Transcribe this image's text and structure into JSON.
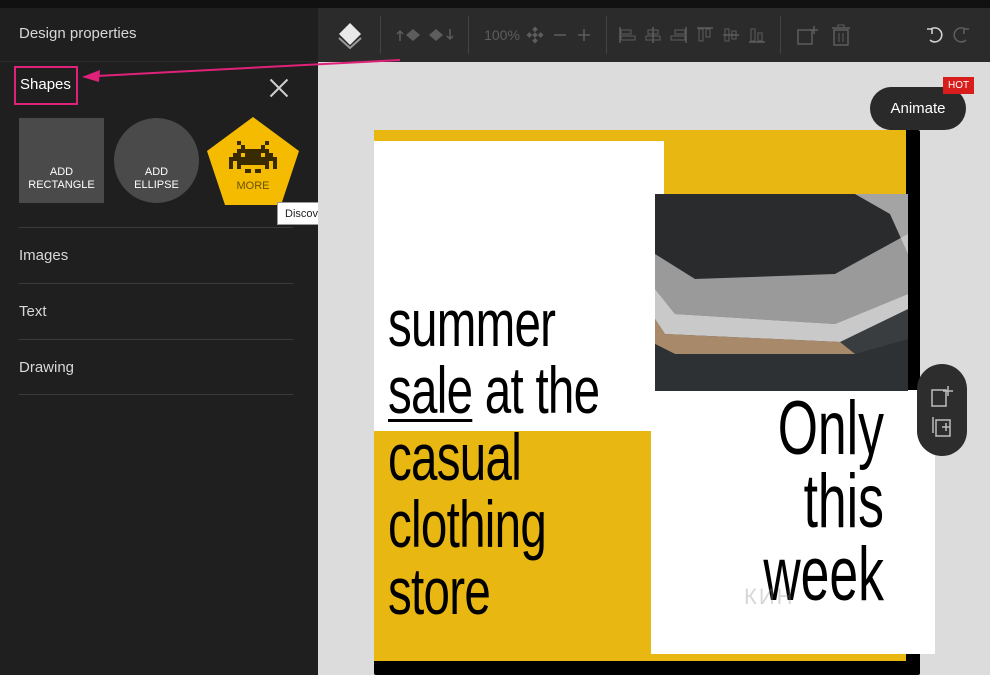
{
  "left_panel": {
    "title": "Design properties",
    "shapes_label": "Shapes",
    "shape_tiles": {
      "rectangle_label": "ADD\nRECTANGLE",
      "ellipse_label": "ADD\nELLIPSE",
      "more_label": "MORE"
    },
    "tooltip": "Discover more shapes",
    "sections": [
      "Images",
      "Text",
      "Drawing"
    ]
  },
  "toolbar": {
    "zoom": "100%"
  },
  "canvas": {
    "main_text_lines": [
      "summer",
      "sale",
      " at the",
      "casual",
      "clothing",
      "store"
    ],
    "side_text_lines": [
      "Only",
      "this",
      "week"
    ],
    "watermark": "КИН"
  },
  "animate": {
    "label": "Animate",
    "badge": "HOT"
  },
  "colors": {
    "accent_pink": "#e0217a",
    "design_yellow": "#e8b712",
    "more_yellow": "#f5bb00",
    "hot_red": "#d81d1d"
  }
}
